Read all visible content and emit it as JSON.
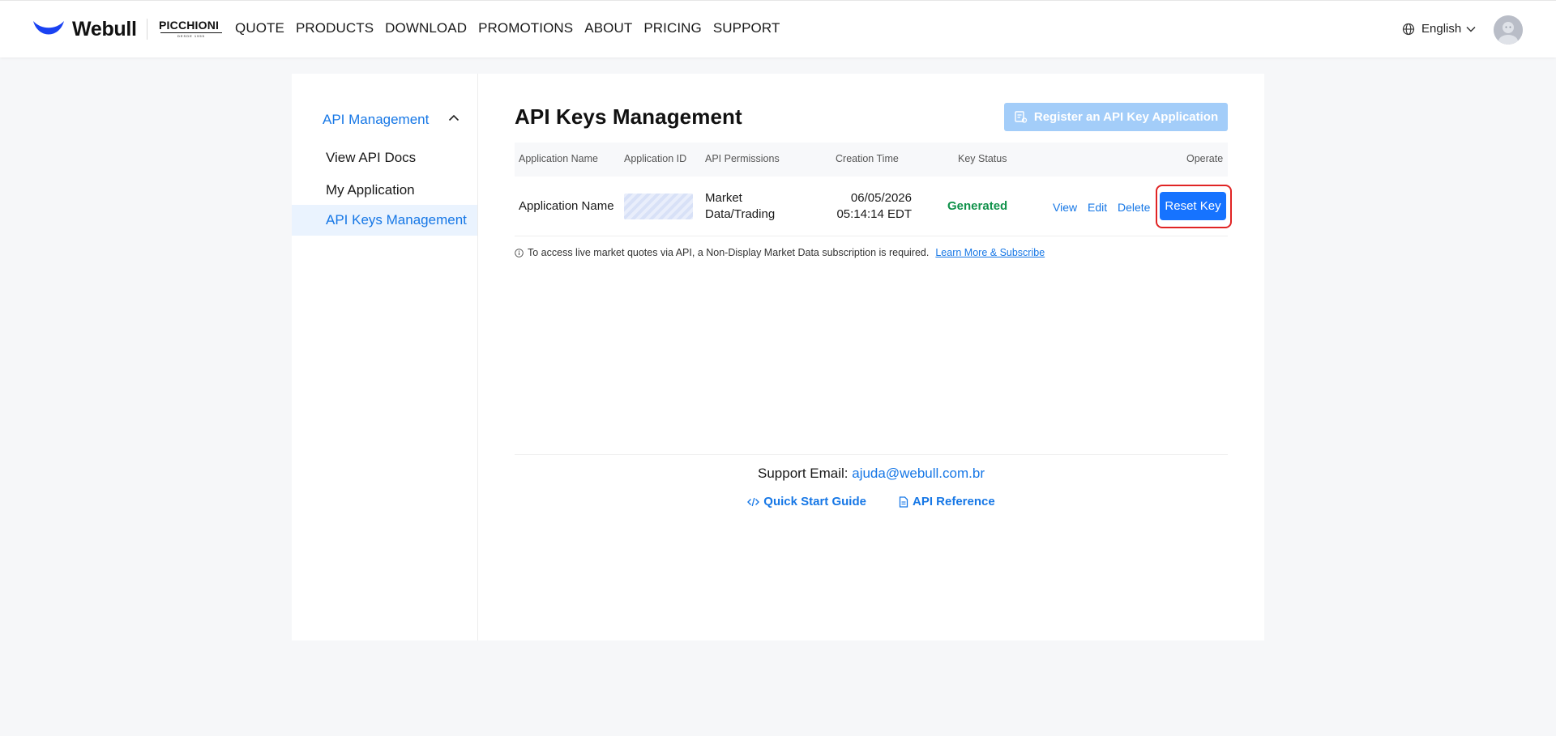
{
  "header": {
    "brand": "Webull",
    "partner": {
      "name": "PICCHIONI",
      "tagline": "DESDE 1955"
    },
    "nav": [
      "QUOTE",
      "PRODUCTS",
      "DOWNLOAD",
      "PROMOTIONS",
      "ABOUT",
      "PRICING",
      "SUPPORT"
    ],
    "language": "English",
    "colors": {
      "brand": "#1a42f2"
    }
  },
  "sidebar": {
    "group_label": "API Management",
    "items": [
      {
        "label": "View API Docs",
        "active": false
      },
      {
        "label": "My Application",
        "active": false
      },
      {
        "label": "API Keys Management",
        "active": true
      }
    ]
  },
  "main": {
    "title": "API Keys Management",
    "register_button": "Register an API Key Application",
    "table": {
      "columns": [
        "Application Name",
        "Application ID",
        "API Permissions",
        "Creation Time",
        "Key Status",
        "Operate"
      ],
      "rows": [
        {
          "name": "Application Name",
          "permissions_line1": "Market",
          "permissions_line2": "Data/Trading",
          "date": "06/05/2026",
          "time": "05:14:14 EDT",
          "status": "Generated",
          "actions": {
            "view": "View",
            "edit": "Edit",
            "delete": "Delete",
            "reset": "Reset Key"
          }
        }
      ]
    },
    "notice": {
      "text": "To access live market quotes via API, a Non-Display Market Data subscription is required.",
      "link": "Learn More & Subscribe"
    },
    "support": {
      "label": "Support Email:",
      "email": "ajuda@webull.com.br"
    },
    "links": [
      "Quick Start Guide",
      "API Reference"
    ],
    "colors": {
      "accent": "#1677e6",
      "status_ok": "#11924b",
      "highlight": "#e02424"
    }
  }
}
